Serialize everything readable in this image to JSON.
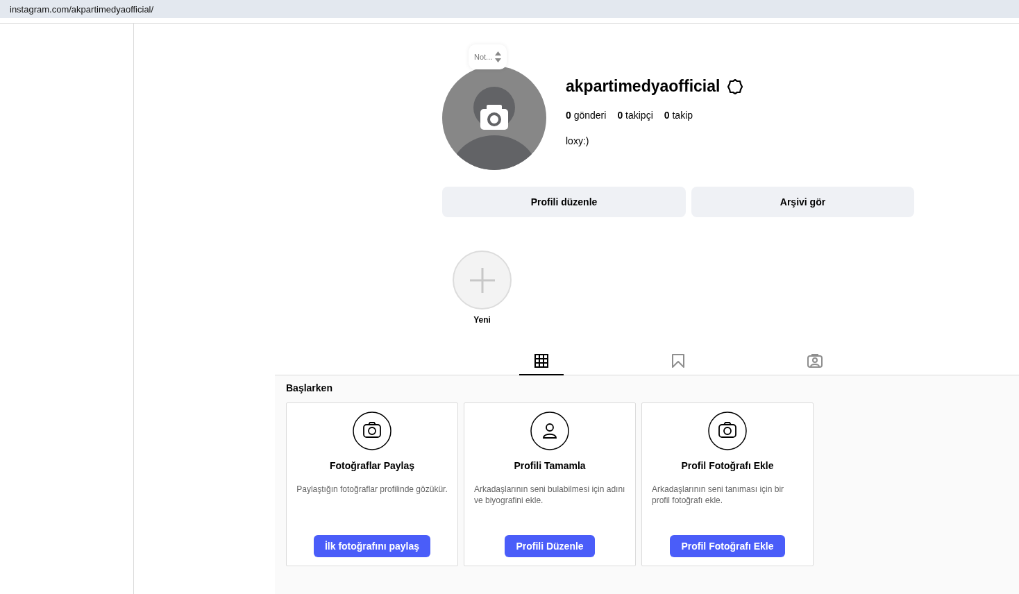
{
  "address_bar": {
    "url": "instagram.com/akpartimedyaofficial/"
  },
  "profile": {
    "note": "Not...",
    "username": "akpartimedyaofficial",
    "stats": [
      "**0** gönderi",
      "**0** takipçi",
      "**0** takip"
    ],
    "bio": "loxy:)"
  },
  "actions": [
    "Profili düzenle",
    "Arşivi gör"
  ],
  "highlight": {
    "label": "Yeni"
  },
  "tabs": [
    {
      "kind": "grid",
      "selected": true
    },
    {
      "kind": "bookmark",
      "selected": false
    },
    {
      "kind": "tagged",
      "selected": false
    }
  ],
  "getting_started": {
    "title": "Başlarken",
    "cards": [
      {
        "kind": "camera",
        "title": "Fotoğraflar Paylaş",
        "text": "Paylaştığın fotoğraflar profilinde gözükür.",
        "button": "İlk fotoğrafını paylaş"
      },
      {
        "kind": "person",
        "title": "Profili Tamamla",
        "text": "Arkadaşlarının seni bulabilmesi için adını ve biyografini ekle.",
        "button": "Profili Düzenle"
      },
      {
        "kind": "camera",
        "title": "Profil Fotoğrafı Ekle",
        "text": "Arkadaşlarının seni tanıması için bir profil fotoğrafı ekle.",
        "button": "Profil Fotoğrafı Ekle"
      }
    ]
  }
}
